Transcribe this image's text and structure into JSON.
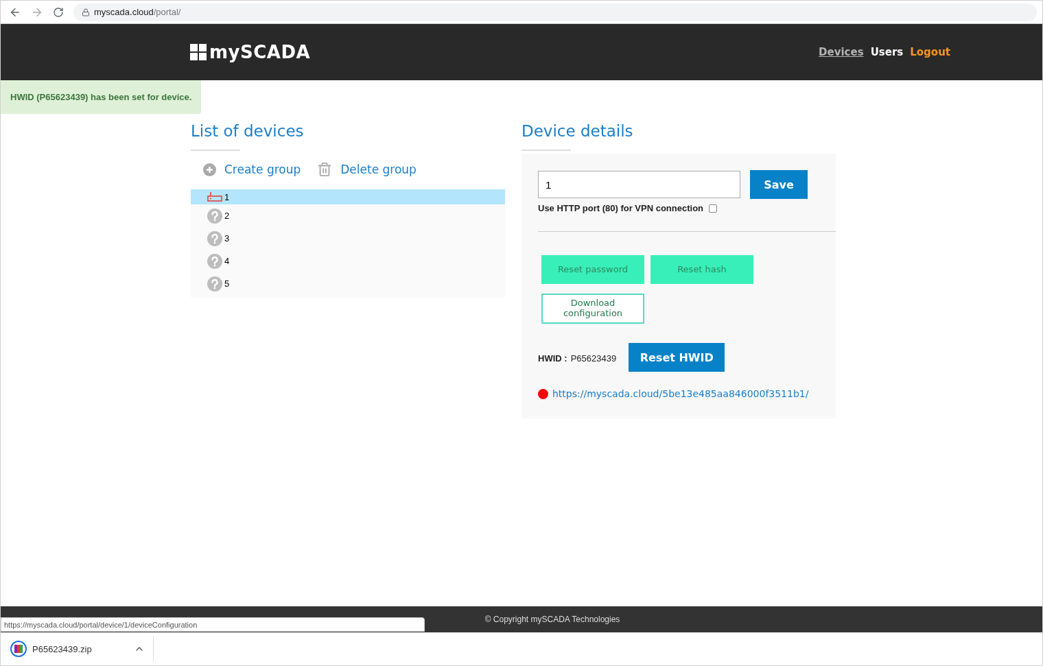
{
  "browser": {
    "url_host": "myscada.cloud",
    "url_path": "/portal/"
  },
  "header": {
    "logo": "mySCADA",
    "nav": [
      {
        "label": "Devices",
        "selected": true,
        "color": "#b4b4b4"
      },
      {
        "label": "Users",
        "selected": false,
        "color": "#ffffff"
      },
      {
        "label": "Logout",
        "selected": false,
        "color": "#f7941d"
      }
    ]
  },
  "alert": {
    "text": "HWID (P65623439) has been set for device."
  },
  "device_list": {
    "title": "List of devices",
    "actions": [
      {
        "label": "Create group",
        "kind": "add"
      },
      {
        "label": "Delete group",
        "kind": "delete"
      }
    ],
    "devices": [
      {
        "name": "1",
        "kind": "router",
        "selected": true
      },
      {
        "name": "2",
        "kind": "unknown",
        "selected": false
      },
      {
        "name": "3",
        "kind": "unknown",
        "selected": false
      },
      {
        "name": "4",
        "kind": "unknown",
        "selected": false
      },
      {
        "name": "5",
        "kind": "unknown",
        "selected": false
      }
    ]
  },
  "device_details": {
    "title": "Device details",
    "name_value": "1",
    "save": "Save",
    "http_port": {
      "label": "Use HTTP port (80) for VPN connection",
      "checked": false
    },
    "buttons": [
      {
        "label": "Reset password",
        "kind": "filled"
      },
      {
        "label": "Reset hash",
        "kind": "filled"
      },
      {
        "label": "Download configuration",
        "kind": "outline"
      }
    ],
    "hwid_label": "HWID :",
    "hwid_value": "P65623439",
    "reset_hwid": "Reset HWID",
    "link": {
      "url": "https://myscada.cloud/5be13e485aa846000f3511b1/",
      "color": "#ff0000"
    }
  },
  "footer": {
    "copyright": "© Copyright mySCADA Technologies"
  },
  "status_url": "https://myscada.cloud/portal/device/1/deviceConfiguration",
  "download": {
    "filename": "P65623439.zip"
  }
}
